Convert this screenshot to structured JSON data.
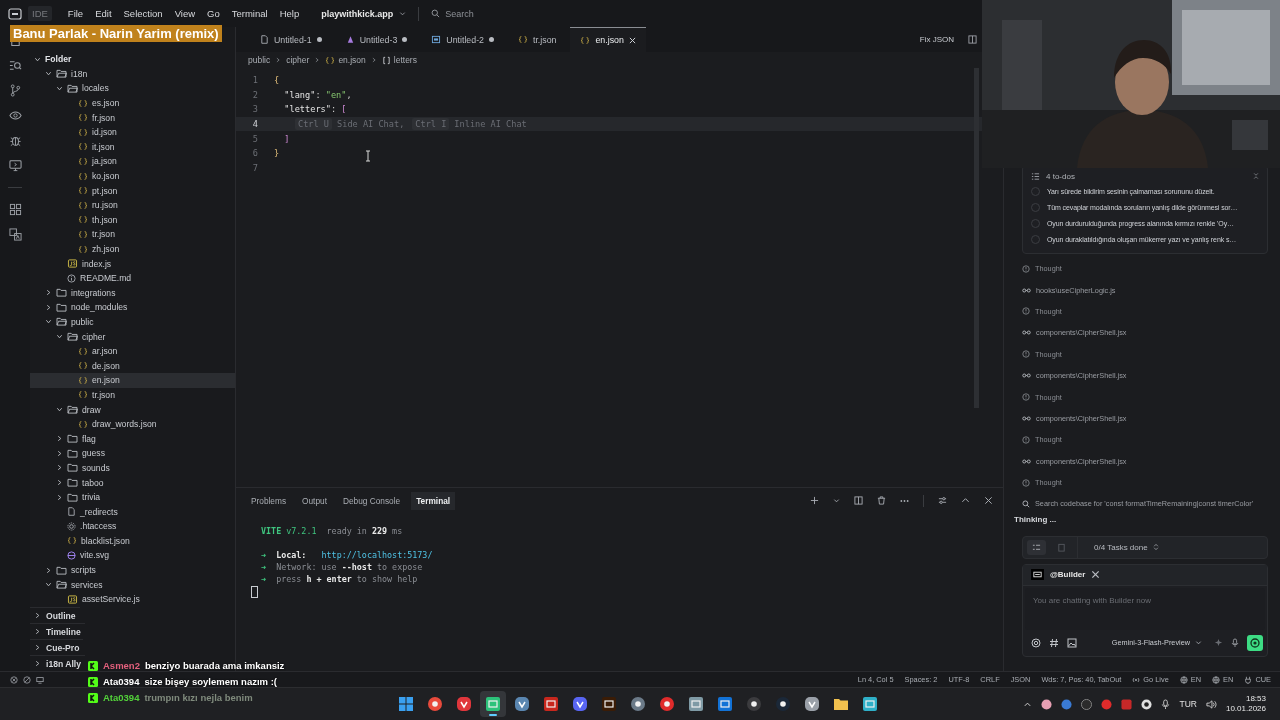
{
  "title_bar": {
    "app_label": "IDE",
    "menu": [
      "File",
      "Edit",
      "Selection",
      "View",
      "Go",
      "Terminal",
      "Help"
    ],
    "project": "playwithkick.app",
    "search_placeholder": "Search"
  },
  "now_playing": "Banu Parlak - Narin Yarim (remix)",
  "tabs": [
    {
      "label": "Untitled-1",
      "kind": "text",
      "modified": true,
      "selected": false
    },
    {
      "label": "Untitled-3",
      "kind": "component",
      "modified": true,
      "selected": false
    },
    {
      "label": "Untitled-2",
      "kind": "preview",
      "modified": true,
      "selected": false
    },
    {
      "label": "tr.json",
      "kind": "json",
      "modified": false,
      "selected": false
    },
    {
      "label": "en.json",
      "kind": "json",
      "modified": false,
      "selected": true
    }
  ],
  "tab_actions": {
    "fix_json": "Fix JSON"
  },
  "breadcrumb": [
    {
      "label": "public",
      "kind": "folder"
    },
    {
      "label": "cipher",
      "kind": "folder"
    },
    {
      "label": "en.json",
      "kind": "json"
    },
    {
      "label": "letters",
      "kind": "array"
    }
  ],
  "editor": {
    "lines": [
      {
        "number": "1",
        "kind": "code",
        "current": false,
        "tokens": [
          {
            "text": "{",
            "kind": "brace"
          }
        ]
      },
      {
        "number": "2",
        "kind": "code",
        "current": false,
        "tokens": [
          {
            "text": "  \"lang\"",
            "kind": "key"
          },
          {
            "text": ": ",
            "kind": "punct"
          },
          {
            "text": "\"en\"",
            "kind": "string"
          },
          {
            "text": ",",
            "kind": "punct"
          }
        ]
      },
      {
        "number": "3",
        "kind": "code",
        "current": false,
        "tokens": [
          {
            "text": "  \"letters\"",
            "kind": "key"
          },
          {
            "text": ": ",
            "kind": "punct"
          },
          {
            "text": "[",
            "kind": "bracket"
          }
        ]
      },
      {
        "number": "4",
        "kind": "hint",
        "current": true,
        "tokens": [
          {
            "text": "Ctrl U",
            "kind": "keycap"
          },
          {
            "text": "Side AI Chat,",
            "kind": "hint"
          },
          {
            "text": "Ctrl I",
            "kind": "keycap"
          },
          {
            "text": "Inline AI Chat",
            "kind": "hint"
          }
        ]
      },
      {
        "number": "5",
        "kind": "code",
        "current": false,
        "tokens": [
          {
            "text": "  ]",
            "kind": "bracket"
          }
        ]
      },
      {
        "number": "6",
        "kind": "code",
        "current": false,
        "tokens": [
          {
            "text": "}",
            "kind": "brace"
          }
        ]
      },
      {
        "number": "7",
        "current": false
      }
    ]
  },
  "sidebar": {
    "tree": [
      {
        "label": "Folder",
        "kind": "root",
        "expanded": true,
        "selected": false,
        "children": [
          {
            "label": "i18n",
            "kind": "folder",
            "expanded": true,
            "selected": false,
            "children": [
              {
                "label": "locales",
                "kind": "folder",
                "expanded": true,
                "selected": false,
                "children": [
                  {
                    "label": "es.json",
                    "kind": "json",
                    "selected": false
                  },
                  {
                    "label": "fr.json",
                    "kind": "json",
                    "selected": false
                  },
                  {
                    "label": "id.json",
                    "kind": "json",
                    "selected": false
                  },
                  {
                    "label": "it.json",
                    "kind": "json",
                    "selected": false
                  },
                  {
                    "label": "ja.json",
                    "kind": "json",
                    "selected": false
                  },
                  {
                    "label": "ko.json",
                    "kind": "json",
                    "selected": false
                  },
                  {
                    "label": "pt.json",
                    "kind": "json",
                    "selected": false
                  },
                  {
                    "label": "ru.json",
                    "kind": "json",
                    "selected": false
                  },
                  {
                    "label": "th.json",
                    "kind": "json",
                    "selected": false
                  },
                  {
                    "label": "tr.json",
                    "kind": "json",
                    "selected": false
                  },
                  {
                    "label": "zh.json",
                    "kind": "json",
                    "selected": false
                  }
                ]
              },
              {
                "label": "index.js",
                "kind": "js",
                "selected": false
              },
              {
                "label": "README.md",
                "kind": "info",
                "selected": false
              }
            ]
          },
          {
            "label": "integrations",
            "kind": "folder",
            "expanded": false,
            "selected": false
          },
          {
            "label": "node_modules",
            "kind": "folder",
            "expanded": false,
            "selected": false
          },
          {
            "label": "public",
            "kind": "folder",
            "expanded": true,
            "selected": false,
            "children": [
              {
                "label": "cipher",
                "kind": "folder",
                "expanded": true,
                "selected": false,
                "children": [
                  {
                    "label": "ar.json",
                    "kind": "json",
                    "selected": false
                  },
                  {
                    "label": "de.json",
                    "kind": "json",
                    "selected": false
                  },
                  {
                    "label": "en.json",
                    "kind": "json",
                    "selected": true
                  },
                  {
                    "label": "tr.json",
                    "kind": "json",
                    "selected": false
                  }
                ]
              },
              {
                "label": "draw",
                "kind": "folder",
                "expanded": true,
                "selected": false,
                "children": [
                  {
                    "label": "draw_words.json",
                    "kind": "json",
                    "selected": false
                  }
                ]
              },
              {
                "label": "flag",
                "kind": "folder",
                "expanded": false,
                "selected": false
              },
              {
                "label": "guess",
                "kind": "folder",
                "expanded": false,
                "selected": false
              },
              {
                "label": "sounds",
                "kind": "folder",
                "expanded": false,
                "selected": false
              },
              {
                "label": "taboo",
                "kind": "folder",
                "expanded": false,
                "selected": false
              },
              {
                "label": "trivia",
                "kind": "folder",
                "expanded": false,
                "selected": false
              },
              {
                "label": "_redirects",
                "kind": "file",
                "selected": false
              },
              {
                "label": ".htaccess",
                "kind": "gear",
                "selected": false
              },
              {
                "label": "blacklist.json",
                "kind": "json",
                "selected": false
              },
              {
                "label": "vite.svg",
                "kind": "svg",
                "selected": false
              }
            ]
          },
          {
            "label": "scripts",
            "kind": "folder",
            "expanded": false,
            "selected": false
          },
          {
            "label": "services",
            "kind": "folder",
            "expanded": true,
            "selected": false,
            "children": [
              {
                "label": "assetService.js",
                "kind": "js",
                "selected": false
              }
            ]
          }
        ]
      }
    ],
    "sections": [
      {
        "label": "Outline",
        "expanded": false
      },
      {
        "label": "Timeline",
        "expanded": false
      },
      {
        "label": "Cue-Pro",
        "expanded": false
      },
      {
        "label": "i18n Ally",
        "expanded": false
      }
    ]
  },
  "panel": {
    "tabs": [
      {
        "label": "Problems",
        "selected": false
      },
      {
        "label": "Output",
        "selected": false
      },
      {
        "label": "Debug Console",
        "selected": false
      },
      {
        "label": "Terminal",
        "selected": true
      }
    ],
    "terminal": [
      {
        "spaced": false,
        "tokens": [
          {
            "text": "VITE",
            "kind": "accent-bold"
          },
          {
            "text": " v7.2.1",
            "kind": "accent"
          },
          {
            "text": "  ready in ",
            "kind": "dim"
          },
          {
            "text": "229",
            "kind": "bright"
          },
          {
            "text": " ms",
            "kind": "dim"
          }
        ]
      },
      {
        "spaced": true,
        "tokens": [
          {
            "text": "➜",
            "kind": "accent"
          },
          {
            "text": "  Local:",
            "kind": "bright"
          },
          {
            "text": "   http://localhost:5173/",
            "kind": "link"
          }
        ]
      },
      {
        "spaced": false,
        "tokens": [
          {
            "text": "➜",
            "kind": "accent"
          },
          {
            "text": "  Network: use ",
            "kind": "dim"
          },
          {
            "text": "--host",
            "kind": "bright"
          },
          {
            "text": " to expose",
            "kind": "dim"
          }
        ]
      },
      {
        "spaced": false,
        "tokens": [
          {
            "text": "➜",
            "kind": "accent"
          },
          {
            "text": "  press ",
            "kind": "dim"
          },
          {
            "text": "h + enter",
            "kind": "bright"
          },
          {
            "text": " to show help",
            "kind": "dim"
          }
        ]
      }
    ]
  },
  "ai_panel": {
    "todos": {
      "title": "4 to-dos",
      "items": [
        {
          "text": "Yarı sürede bildirim sesinin çalmaması sorununu düzelt.",
          "done": false
        },
        {
          "text": "Tüm cevaplar modalında soruların yanlış dilde görünmesi sor…",
          "done": false
        },
        {
          "text": "Oyun durdurulduğunda progress alanında kırmızı renkle 'Oy…",
          "done": false
        },
        {
          "text": "Oyun duraklatıldığında oluşan mükerrer yazı ve yanlış renk s…",
          "done": false
        }
      ]
    },
    "steps": [
      {
        "kind": "thought",
        "text": "Thought"
      },
      {
        "kind": "read",
        "text": "hooks\\useCipherLogic.js"
      },
      {
        "kind": "thought",
        "text": "Thought"
      },
      {
        "kind": "read",
        "text": "components\\CipherShell.jsx"
      },
      {
        "kind": "thought",
        "text": "Thought"
      },
      {
        "kind": "read",
        "text": "components\\CipherShell.jsx"
      },
      {
        "kind": "thought",
        "text": "Thought"
      },
      {
        "kind": "read",
        "text": "components\\CipherShell.jsx"
      },
      {
        "kind": "thought",
        "text": "Thought"
      },
      {
        "kind": "read",
        "text": "components\\CipherShell.jsx"
      },
      {
        "kind": "thought",
        "text": "Thought"
      },
      {
        "kind": "search",
        "text": "Search codebase for 'const formatTimeRemaining|const timerColor'"
      }
    ],
    "status": "Thinking ...",
    "tasks": "0/4 Tasks done",
    "chat": {
      "agent": "@Builder",
      "placeholder": "You are chatting with Builder now",
      "model": "Gemini-3-Flash-Preview"
    }
  },
  "stream_chat": [
    {
      "user": "Asmen2",
      "color": "#e2607c",
      "text": "benziyo buarada ama imkansiz",
      "fading": false
    },
    {
      "user": "Ata0394",
      "color": "#ffffff",
      "text": "size bişey soylemem nazım :(",
      "fading": false
    },
    {
      "user": "Ata0394",
      "color": "#53d23a",
      "text": "trumpın kızı nejla benim",
      "fading": true
    }
  ],
  "status_bar": {
    "items": [
      {
        "text": "Ln 4, Col 5",
        "kind": "plain"
      },
      {
        "text": "Spaces: 2",
        "kind": "plain"
      },
      {
        "text": "UTF-8",
        "kind": "plain"
      },
      {
        "text": "CRLF",
        "kind": "plain"
      },
      {
        "text": "JSON",
        "kind": "plain"
      },
      {
        "text": "Wds: 7, Pos: 40, TabOut",
        "kind": "plain"
      },
      {
        "text": "Go Live",
        "kind": "broadcast"
      },
      {
        "text": "EN",
        "kind": "globe"
      },
      {
        "text": "EN",
        "kind": "globe"
      },
      {
        "text": "CUE",
        "kind": "plug"
      }
    ]
  },
  "taskbar": {
    "apps": [
      {
        "kind": "start",
        "selected": false
      },
      {
        "kind": "chrome",
        "selected": false
      },
      {
        "kind": "vivaldi",
        "selected": false
      },
      {
        "kind": "ide",
        "selected": true
      },
      {
        "kind": "elephant",
        "selected": false
      },
      {
        "kind": "filezilla",
        "selected": false
      },
      {
        "kind": "discord",
        "selected": false
      },
      {
        "kind": "illustrator",
        "selected": false
      },
      {
        "kind": "davinci",
        "selected": false
      },
      {
        "kind": "player",
        "selected": false
      },
      {
        "kind": "window",
        "selected": false
      },
      {
        "kind": "outlook",
        "selected": false
      },
      {
        "kind": "obs",
        "selected": false
      },
      {
        "kind": "steam",
        "selected": false
      },
      {
        "kind": "tool",
        "selected": false
      },
      {
        "kind": "folder",
        "selected": false
      },
      {
        "kind": "notes",
        "selected": false
      }
    ],
    "tray": {
      "language": "TUR",
      "time": "18:53",
      "date": "10.01.2026"
    }
  }
}
